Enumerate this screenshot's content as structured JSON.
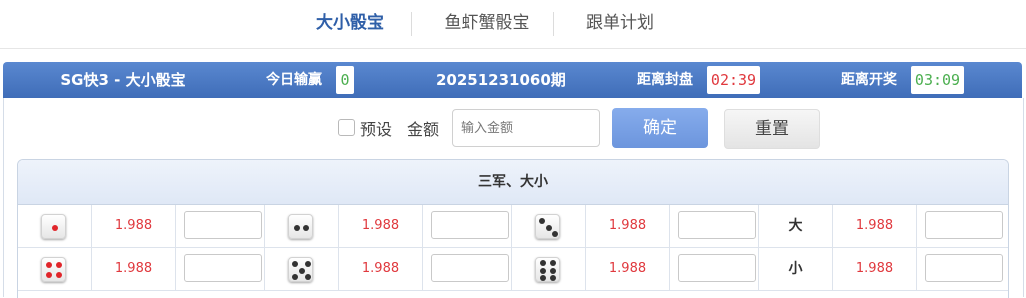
{
  "tabs": [
    {
      "label": "大小骰宝",
      "active": true
    },
    {
      "label": "鱼虾蟹骰宝",
      "active": false
    },
    {
      "label": "跟单计划",
      "active": false
    }
  ],
  "infobar": {
    "title": "SG快3 - 大小骰宝",
    "today_label": "今日输赢",
    "today_value": "0",
    "period": "20251231060期",
    "close_label": "距离封盘",
    "close_time": "02:39",
    "open_label": "距离开奖",
    "open_time": "03:09"
  },
  "controls": {
    "preset_label": "预设",
    "amount_label": "金额",
    "amount_placeholder": "输入金额",
    "confirm_label": "确定",
    "reset_label": "重置"
  },
  "table": {
    "header": "三军、大小",
    "rows": [
      [
        {
          "face": 1,
          "odds": "1.988"
        },
        {
          "face": 2,
          "odds": "1.988"
        },
        {
          "face": 3,
          "odds": "1.988"
        },
        {
          "label": "大",
          "odds": "1.988"
        }
      ],
      [
        {
          "face": 4,
          "odds": "1.988"
        },
        {
          "face": 5,
          "odds": "1.988"
        },
        {
          "face": 6,
          "odds": "1.988"
        },
        {
          "label": "小",
          "odds": "1.988"
        }
      ]
    ]
  },
  "colors": {
    "accent": "#2f5fa8",
    "bar": "#4a78c4",
    "odds": "#e0393e",
    "today_value": "#4caf50",
    "close_time": "#e0393e",
    "open_time": "#4caf50",
    "die_red_pip": "#e0262b"
  }
}
